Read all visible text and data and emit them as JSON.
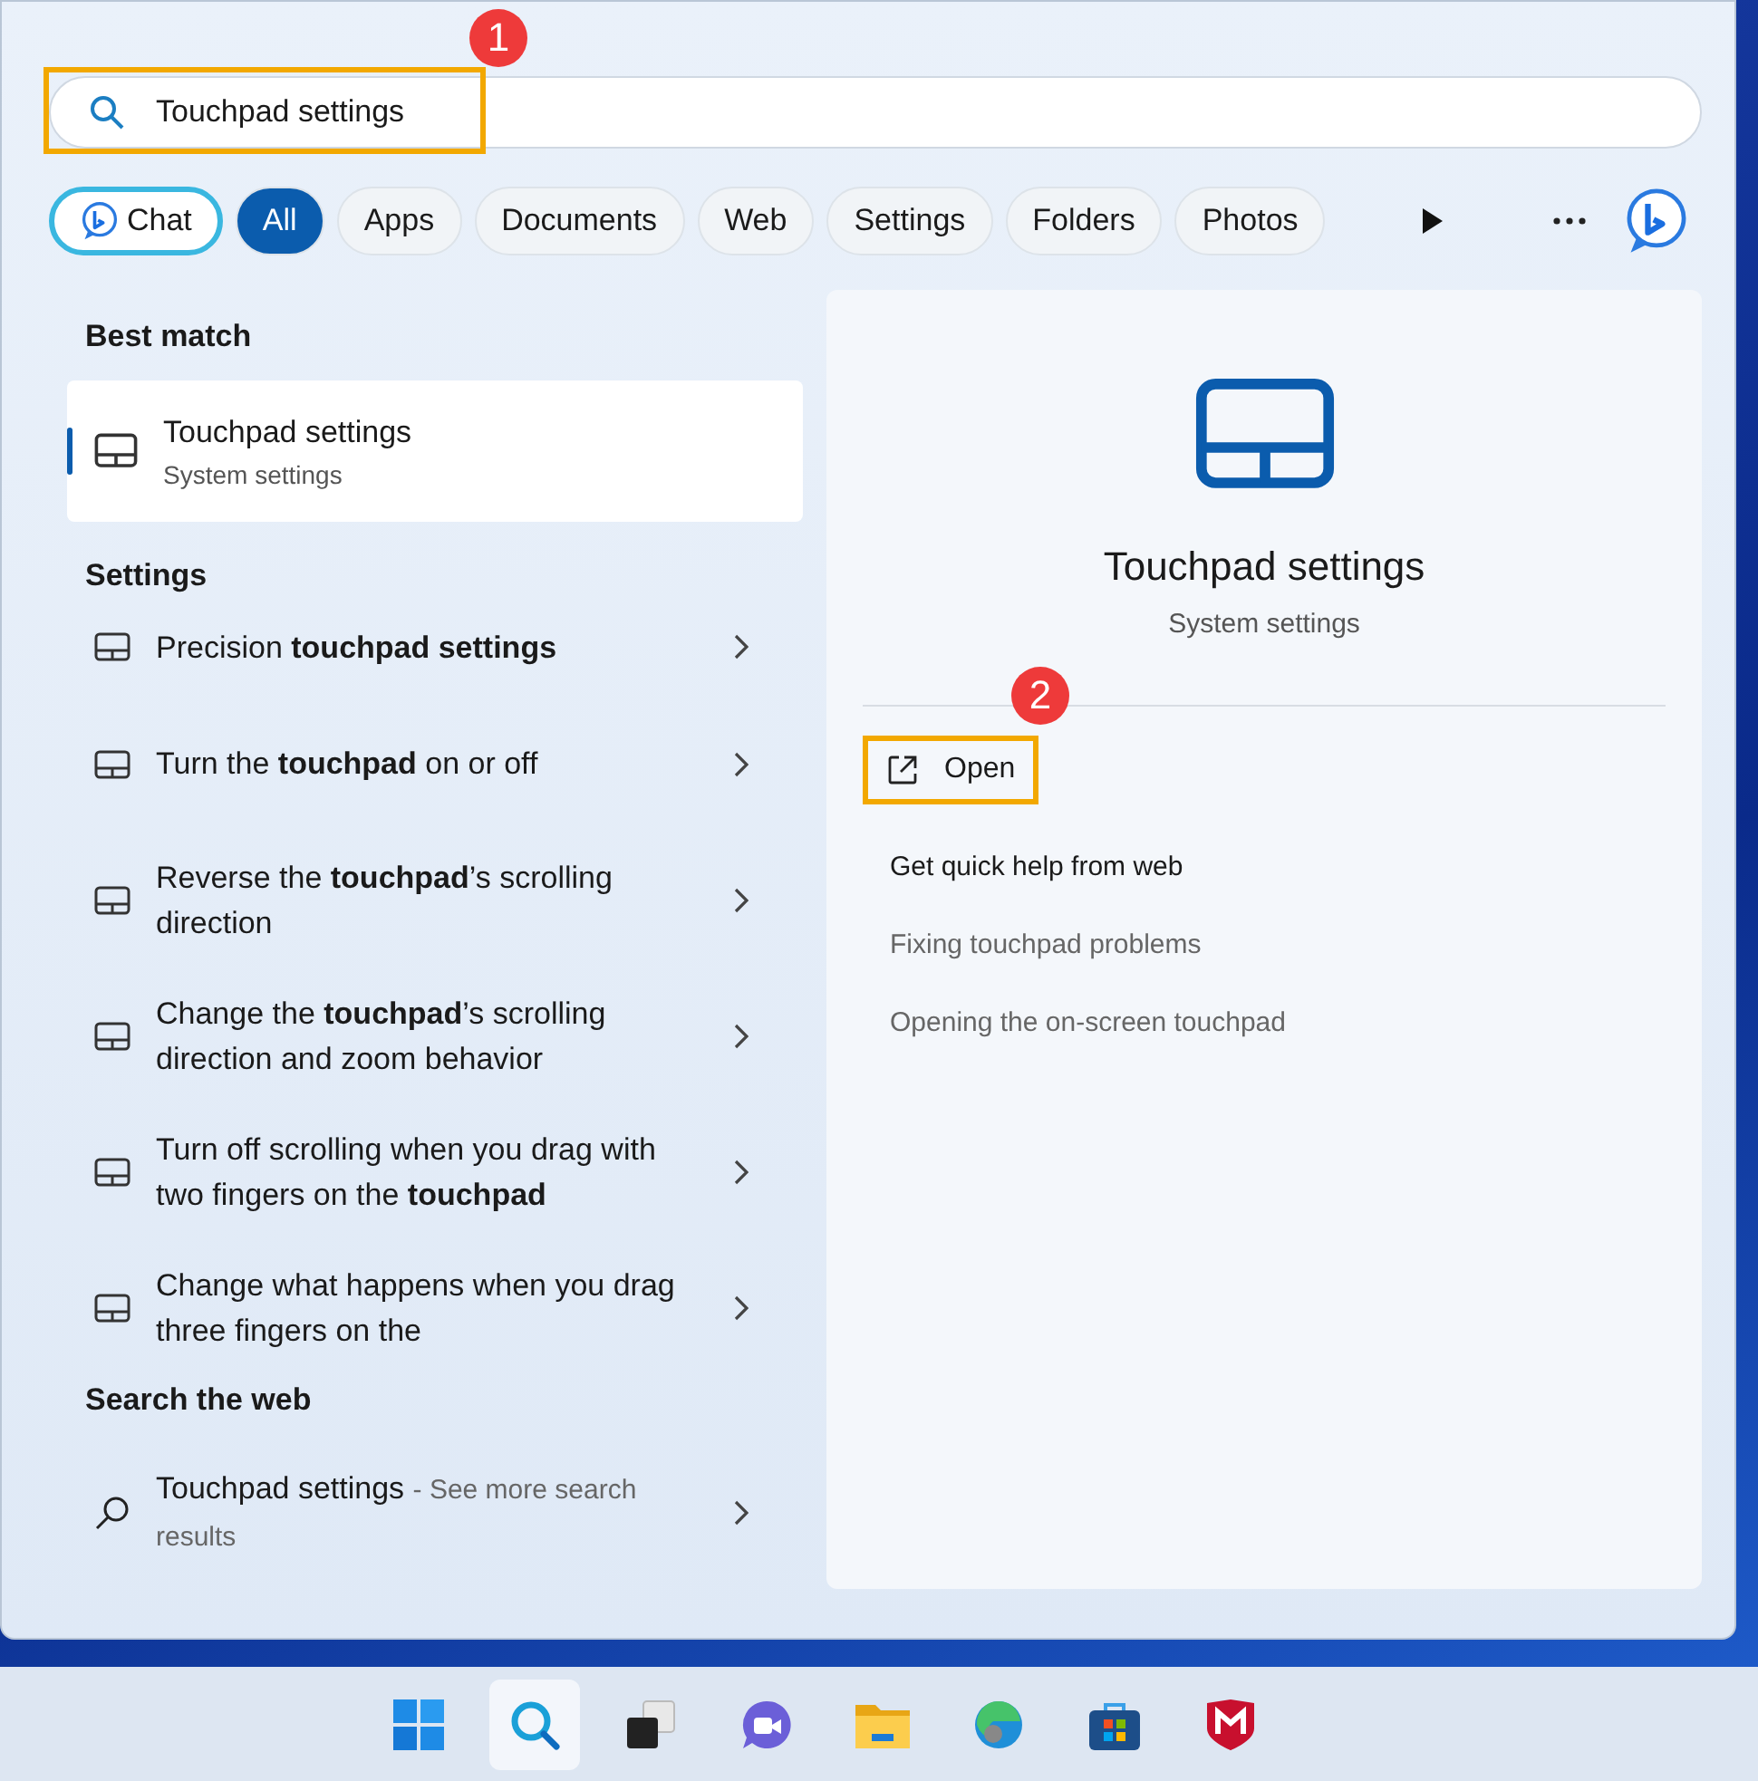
{
  "search": {
    "value": "Touchpad settings",
    "annotation": "1"
  },
  "filters": [
    {
      "label": "Chat",
      "kind": "chat",
      "selected": false
    },
    {
      "label": "All",
      "kind": "pill",
      "selected": true
    },
    {
      "label": "Apps",
      "kind": "pill",
      "selected": false
    },
    {
      "label": "Documents",
      "kind": "pill",
      "selected": false
    },
    {
      "label": "Web",
      "kind": "pill",
      "selected": false
    },
    {
      "label": "Settings",
      "kind": "pill",
      "selected": false
    },
    {
      "label": "Folders",
      "kind": "pill",
      "selected": false
    },
    {
      "label": "Photos",
      "kind": "pill",
      "selected": false
    }
  ],
  "best_match": {
    "heading": "Best match",
    "title": "Touchpad settings",
    "subtitle": "System settings",
    "selected": true
  },
  "settings": {
    "heading": "Settings",
    "items": [
      {
        "text": "Precision **touchpad settings**"
      },
      {
        "text": "Turn the **touchpad** on or off"
      },
      {
        "text": "Reverse the **touchpad**’s scrolling direction"
      },
      {
        "text": "Change the **touchpad**’s scrolling direction and zoom behavior"
      },
      {
        "text": "Turn off scrolling when you drag with two fingers on the **touchpad**"
      },
      {
        "text": "Change what happens when you drag three fingers on the"
      }
    ]
  },
  "web": {
    "heading": "Search the web",
    "title": "Touchpad settings",
    "suffix": "- See more search results"
  },
  "detail": {
    "title": "Touchpad settings",
    "subtitle": "System settings",
    "open": {
      "label": "Open",
      "annotation": "2"
    },
    "help_heading": "Get quick help from web",
    "links": [
      "Fixing touchpad problems",
      "Opening the on-screen touchpad"
    ]
  },
  "taskbar": [
    {
      "kind": "start",
      "selected": false
    },
    {
      "kind": "search",
      "selected": true
    },
    {
      "kind": "taskview",
      "selected": false
    },
    {
      "kind": "meet",
      "selected": false
    },
    {
      "kind": "folder",
      "selected": false
    },
    {
      "kind": "edge",
      "selected": false
    },
    {
      "kind": "store",
      "selected": false
    },
    {
      "kind": "shield",
      "selected": false
    }
  ]
}
